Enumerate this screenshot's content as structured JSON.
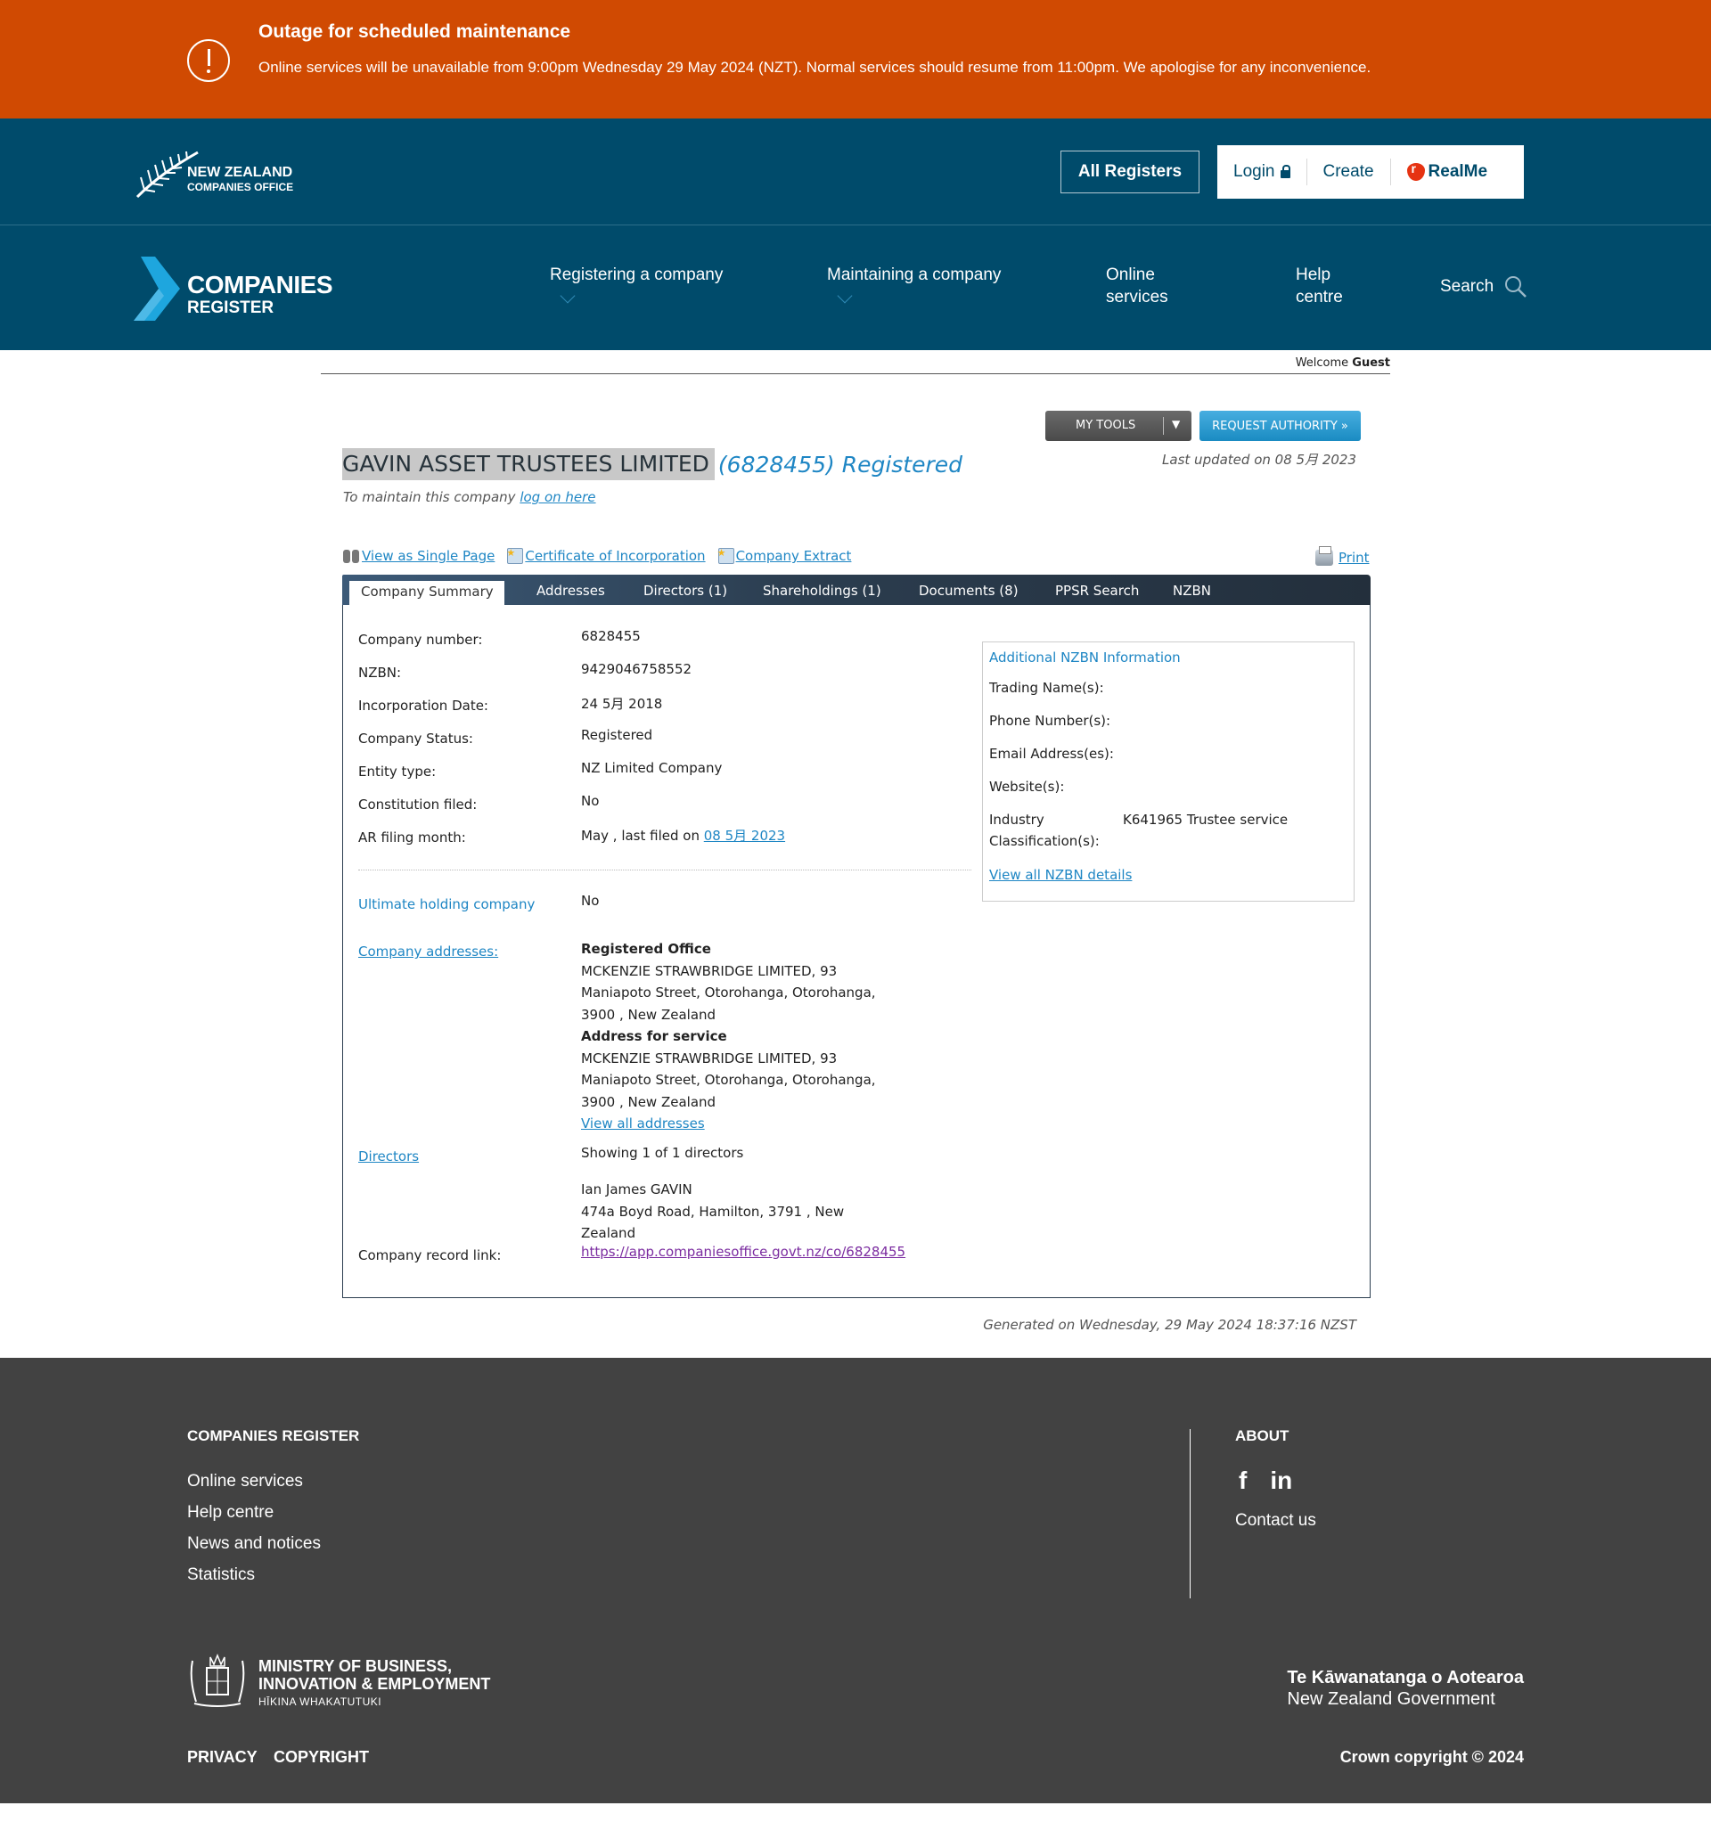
{
  "outage": {
    "title": "Outage for scheduled maintenance",
    "message": "Online services will be unavailable from 9:00pm Wednesday 29 May 2024 (NZT). Normal services should resume from 11:00pm. We apologise for any inconvenience.",
    "icon": "alert-circle-icon",
    "color": "#d04a02"
  },
  "header": {
    "brand_line1": "NEW ZEALAND",
    "brand_line2": "COMPANIES OFFICE",
    "all_registers": "All Registers",
    "login": "Login",
    "create": "Create",
    "realme": "RealMe",
    "register_title": "COMPANIES",
    "register_subtitle": "REGISTER",
    "nav": [
      {
        "label": "Registering a company",
        "has_dropdown": true
      },
      {
        "label": "Maintaining a company",
        "has_dropdown": true
      },
      {
        "label_line1": "Online",
        "label_line2": "services"
      },
      {
        "label_line1": "Help",
        "label_line2": "centre"
      }
    ],
    "search": "Search",
    "bg_color": "#004b6b"
  },
  "welcome": {
    "prefix": "Welcome",
    "user": "Guest"
  },
  "toolbar": {
    "my_tools": "MY TOOLS",
    "request_authority": "REQUEST AUTHORITY »",
    "last_updated": "Last updated on 08 5月 2023"
  },
  "company": {
    "name": "GAVIN ASSET TRUSTEES LIMITED",
    "number_status": "(6828455) Registered",
    "maintain_prefix": "To maintain this company",
    "maintain_link": "log on here"
  },
  "quick_links": {
    "single_page": "View as Single Page",
    "certificate": "Certificate of Incorporation",
    "extract": "Company Extract",
    "print": "Print"
  },
  "tabs": [
    {
      "label": "Company Summary",
      "active": true
    },
    {
      "label": "Addresses"
    },
    {
      "label": "Directors (1)"
    },
    {
      "label": "Shareholdings (1)"
    },
    {
      "label": "Documents (8)"
    },
    {
      "label": "PPSR Search"
    },
    {
      "label": "NZBN"
    }
  ],
  "summary": {
    "rows": [
      {
        "label": "Company number:",
        "value": "6828455"
      },
      {
        "label": "NZBN:",
        "value": "9429046758552"
      },
      {
        "label": "Incorporation Date:",
        "value": "24 5月 2018"
      },
      {
        "label": "Company Status:",
        "value": "Registered"
      },
      {
        "label": "Entity type:",
        "value": "NZ Limited Company"
      },
      {
        "label": "Constitution filed:",
        "value": "No"
      },
      {
        "label": "AR filing month:",
        "value_prefix": "May , last filed on",
        "value_link": "08 5月 2023"
      }
    ],
    "ultimate_holding_label": "Ultimate holding company",
    "ultimate_holding_value": "No",
    "addresses_label": "Company addresses:",
    "registered_office_heading": "Registered Office",
    "registered_office_lines": [
      "MCKENZIE STRAWBRIDGE LIMITED, 93",
      "Maniapoto Street, Otorohanga, Otorohanga,",
      "3900 , New Zealand"
    ],
    "service_heading": "Address for service",
    "service_lines": [
      "MCKENZIE STRAWBRIDGE LIMITED, 93",
      "Maniapoto Street, Otorohanga, Otorohanga,",
      "3900 , New Zealand"
    ],
    "view_all_addresses": "View all addresses",
    "directors_label": "Directors",
    "directors_showing": "Showing 1 of 1 directors",
    "director_name": "Ian James GAVIN",
    "director_address_lines": [
      "474a Boyd Road, Hamilton, 3791 , New",
      "Zealand"
    ],
    "record_link_label": "Company record link:",
    "record_link": "https://app.companiesoffice.govt.nz/co/6828455"
  },
  "nzbn_info": {
    "title": "Additional NZBN Information",
    "trading_names": "Trading Name(s):",
    "phone_numbers": "Phone Number(s):",
    "email_addresses": "Email Address(es):",
    "websites": "Website(s):",
    "industry_label_1": "Industry",
    "industry_label_2": "Classification(s):",
    "industry_value": "K641965 Trustee service",
    "view_all": "View all NZBN details"
  },
  "generated": "Generated on Wednesday, 29 May 2024 18:37:16 NZST",
  "footer": {
    "col1_heading": "COMPANIES REGISTER",
    "col1_links": [
      "Online services",
      "Help centre",
      "News and notices",
      "Statistics"
    ],
    "col2_heading": "ABOUT",
    "facebook": "f",
    "linkedin": "in",
    "contact": "Contact us",
    "mbie_line1": "MINISTRY OF BUSINESS,",
    "mbie_line2": "INNOVATION & EMPLOYMENT",
    "mbie_line3": "HĪKINA WHAKATUTUKI",
    "govt_line1": "Te Kāwanatanga o Aotearoa",
    "govt_line2": "New Zealand Government",
    "privacy": "PRIVACY",
    "copyright": "COPYRIGHT",
    "crown_copyright": "Crown copyright © 2024"
  }
}
